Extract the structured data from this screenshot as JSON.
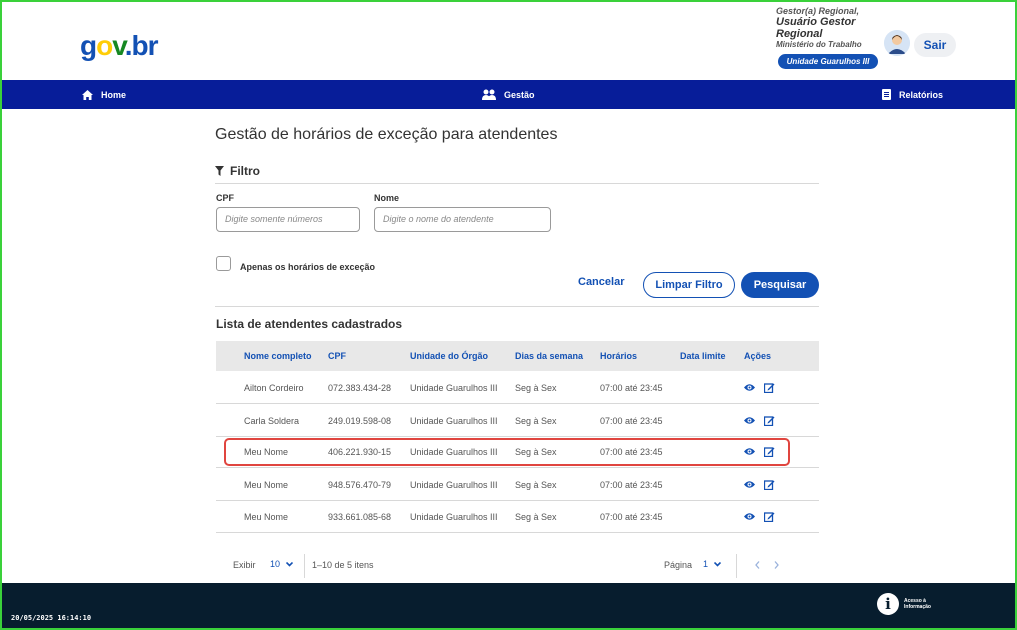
{
  "header": {
    "logo": {
      "g": "g",
      "o": "o",
      "v": "v",
      "dot": ".",
      "br": "br"
    },
    "user_role": "Gestor(a) Regional,",
    "user_name": "Usuário Gestor Regional",
    "ministry": "Ministério do Trabalho",
    "unit": "Unidade Guarulhos III",
    "logout_label": "Sair"
  },
  "nav": {
    "home": "Home",
    "gestao": "Gestão",
    "relatorios": "Relatórios"
  },
  "main": {
    "title": "Gestão de horários de exceção para atendentes",
    "filter_title": "Filtro",
    "cpf_label": "CPF",
    "cpf_placeholder": "Digite somente números",
    "nome_label": "Nome",
    "nome_placeholder": "Digite o nome do atendente",
    "checkbox_label": "Apenas os horários de exceção",
    "cancel_label": "Cancelar",
    "clear_label": "Limpar Filtro",
    "search_label": "Pesquisar",
    "list_title": "Lista de atendentes cadastrados"
  },
  "table": {
    "headers": [
      "Nome completo",
      "CPF",
      "Unidade do Órgão",
      "Dias da semana",
      "Horários",
      "Data limite",
      "Ações"
    ],
    "rows": [
      {
        "nome": "Ailton Cordeiro",
        "cpf": "072.383.434-28",
        "unidade": "Unidade Guarulhos III",
        "dias": "Seg à Sex",
        "horarios": "07:00 até 23:45",
        "data_limite": ""
      },
      {
        "nome": "Carla Soldera",
        "cpf": "249.019.598-08",
        "unidade": "Unidade Guarulhos III",
        "dias": "Seg à Sex",
        "horarios": "07:00 até 23:45",
        "data_limite": ""
      },
      {
        "nome": "Meu Nome",
        "cpf": "406.221.930-15",
        "unidade": "Unidade Guarulhos III",
        "dias": "Seg à Sex",
        "horarios": "07:00 até 23:45",
        "data_limite": ""
      },
      {
        "nome": "Meu Nome",
        "cpf": "948.576.470-79",
        "unidade": "Unidade Guarulhos III",
        "dias": "Seg à Sex",
        "horarios": "07:00 até 23:45",
        "data_limite": ""
      },
      {
        "nome": "Meu Nome",
        "cpf": "933.661.085-68",
        "unidade": "Unidade Guarulhos III",
        "dias": "Seg à Sex",
        "horarios": "07:00 até 23:45",
        "data_limite": ""
      }
    ],
    "highlighted_row": 2
  },
  "pagination": {
    "show_label": "Exibir",
    "page_size": "10",
    "range_text": "1–10 de 5 itens",
    "page_label": "Página",
    "page_value": "1"
  },
  "footer": {
    "timestamp": "20/05/2025 16:14:10",
    "acesso_line1": "Acesso à",
    "acesso_line2": "Informação"
  },
  "colors": {
    "primary": "#1351b4",
    "nav_bg": "#071d99",
    "footer_bg": "#071d2e",
    "highlight": "#e0453f",
    "frame": "#3ad13a"
  }
}
